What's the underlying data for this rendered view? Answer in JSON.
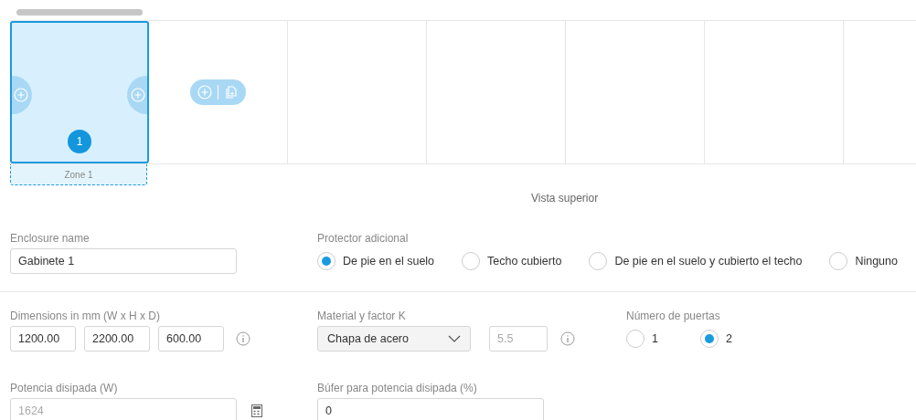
{
  "top_view": {
    "zones": [
      {
        "label": "Zone 1",
        "number": "1",
        "selected": true
      }
    ],
    "caption": "Vista superior"
  },
  "enclosure_name": {
    "label": "Enclosure name",
    "value": "Gabinete 1"
  },
  "protector": {
    "label": "Protector adicional",
    "options": [
      {
        "label": "De pie en el suelo",
        "selected": true
      },
      {
        "label": "Techo cubierto",
        "selected": false
      },
      {
        "label": "De pie en el suelo y cubierto el techo",
        "selected": false
      },
      {
        "label": "Ninguno",
        "selected": false
      }
    ]
  },
  "dimensions": {
    "label": "Dimensions in mm (W x H x D)",
    "values": [
      "1200.00",
      "2200.00",
      "600.00"
    ]
  },
  "material": {
    "label": "Material y factor K",
    "value": "Chapa de acero",
    "k_factor": {
      "value": "5.5",
      "disabled": true
    }
  },
  "doors": {
    "label": "Número de puertas",
    "options": [
      {
        "label": "1",
        "selected": false
      },
      {
        "label": "2",
        "selected": true
      }
    ]
  },
  "power": {
    "label": "Potencia disipada (W)",
    "value": "1624",
    "disabled": true
  },
  "buffer": {
    "label": "Búfer para potencia disipada (%)",
    "value": "0"
  }
}
